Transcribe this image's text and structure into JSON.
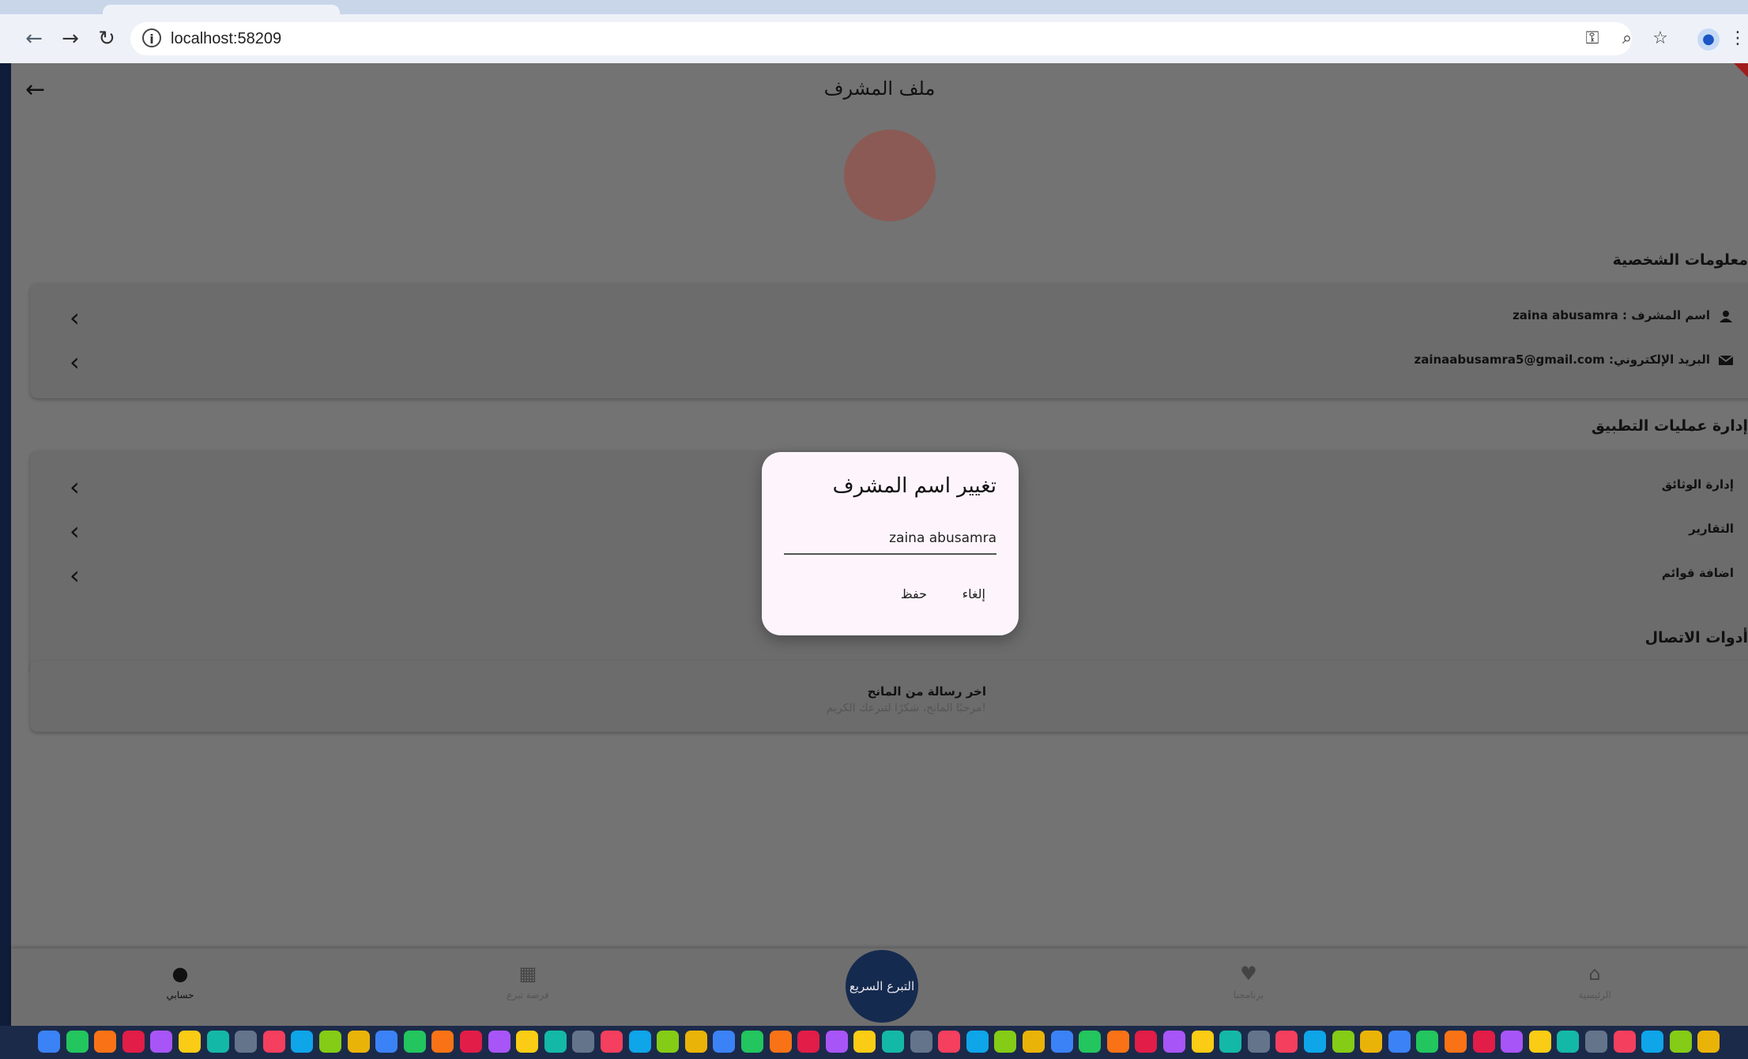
{
  "browser": {
    "url": "localhost:58209",
    "icons": [
      "back-arrow-icon",
      "forward-arrow-icon",
      "reload-icon",
      "site-info-icon",
      "key-icon",
      "zoom-icon",
      "star-icon",
      "profile-icon",
      "menu-icon"
    ]
  },
  "page": {
    "title": "ملف المشرف",
    "sections": {
      "personal": "معلومات الشخصية",
      "app_ops": "إدارة عمليات التطبيق",
      "contact": "أدوات الاتصال"
    },
    "personal_rows": [
      {
        "text": "اسم المشرف : zaina abusamra",
        "icon": "person-icon"
      },
      {
        "text": "البريد الإلكتروني: zainaabusamra5@gmail.com",
        "icon": "mail-icon"
      }
    ],
    "ops_rows": [
      {
        "text": "إدارة الوثائق"
      },
      {
        "text": "التقارير"
      },
      {
        "text": "اضافة قوائم"
      }
    ],
    "last_message": {
      "title": "اخر رسالة من المانح",
      "text": "مرحبًا المانح، شكرًا لتبرعك الكريم!"
    }
  },
  "dialog": {
    "title": "تغيير اسم المشرف",
    "input_value": "zaina abusamra",
    "cancel_label": "إلغاء",
    "save_label": "حفظ"
  },
  "bottom_nav": {
    "items": [
      {
        "label": "حسابي",
        "icon": "person-icon"
      },
      {
        "label": "فرصة تبرع",
        "icon": "grid-icon"
      },
      {
        "label": "برنامجنا",
        "icon": "hand-heart-icon"
      },
      {
        "label": "الرئيسية",
        "icon": "home-icon"
      }
    ],
    "quick_donate": "التبرع السريع"
  },
  "colors": {
    "overlay_page": "#737373",
    "dialog_bg": "#fdf5fb",
    "quick_donate_bg": "#152a4f",
    "avatar": "#8b5a55"
  }
}
